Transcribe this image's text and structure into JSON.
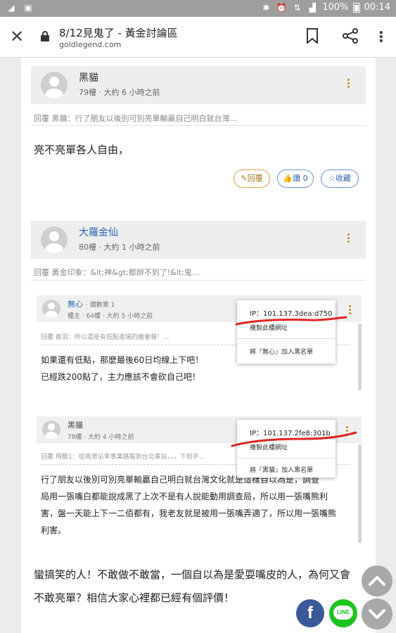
{
  "status_bar": {
    "battery": "100%",
    "time": "00:14"
  },
  "app_bar": {
    "title": "8/12見鬼了 - 黃金討論區",
    "url": "goldlegend.com"
  },
  "post1": {
    "author": "黑貓",
    "floor": "79樓",
    "time": "大約 6 小時之前",
    "reply_ref": "回覆 黑貓：行了朋友以後別可別亮單輸贏自己明白就台灣...",
    "body": "亮不亮單各人自由，",
    "reply_label": "回覆",
    "like_label": "讚 0",
    "fav_label": "收藏"
  },
  "post2": {
    "author": "大羅金仙",
    "floor": "80樓",
    "time": "大約 1 小時之前",
    "reply_ref": "回覆 黃金印象：&lt;神&gt;都辦不到了!&lt;鬼...",
    "quote1": {
      "author": "無心",
      "tag": "‧ 讚數第 1",
      "meta": "樓主 ‧ 64樓 ‧ 大約 5 小時之前",
      "ref": "回覆 賓羽：所以還是有低點進場的機會囉！...",
      "line1": "如果還有低點，那麼最後60日均線上下吧！",
      "line2": "已經跌200點了，主力應該不會砍自己吧！",
      "popup": {
        "ip": "IP：101.137.3dea:d750",
        "copy": "複製此樓網址",
        "block": "將『無心』加入黑名單"
      }
    },
    "quote2": {
      "author": "黑貓",
      "meta": "78樓 ‧ 大約 4 小時之前",
      "ref": "回覆 飛獸1：從南港沿幸事業路報到台北車站，，，下到手...",
      "line1": "行了朋友以後別可別亮單輸贏自己明白就台灣文化就是這樣自以為是，調查",
      "line2": "局用一張嘴白都能說成黑了上次不是有人說能動用調查局，所以用一張嘴熊利",
      "line3": "害，盤一天能上下一二佰都有，我老友就是被用一張嘴弄適了，所以用一張嘴熊",
      "line4": "利害。",
      "popup": {
        "ip": "IP：101.137.2fe8:301b",
        "copy": "複製此樓網址",
        "block": "將『黑貓』加入黑名單"
      }
    },
    "body_line1": "蠻搞笑的人！不敢做不敢當，一個自以為是愛耍嘴皮的人，為何又會",
    "body_line2": "不敢亮單？相信大家心裡都已經有個評價！"
  },
  "fabs": {
    "facebook": "f",
    "line": "LINE"
  }
}
